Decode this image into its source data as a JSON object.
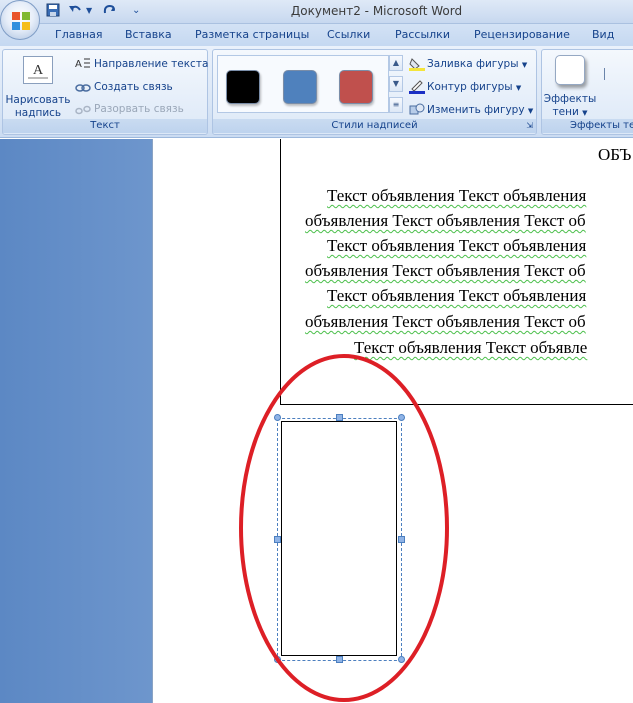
{
  "window": {
    "title": "Документ2 - Microsoft Word"
  },
  "tabs": [
    "Главная",
    "Вставка",
    "Разметка страницы",
    "Ссылки",
    "Рассылки",
    "Рецензирование",
    "Вид"
  ],
  "ribbon": {
    "text_group": {
      "label": "Текст",
      "draw_button": "Нарисовать надпись",
      "text_direction": "Направление текста",
      "create_link": "Создать связь",
      "break_link": "Разорвать связь"
    },
    "styles_group": {
      "label": "Стили надписей",
      "swatches": [
        "#000000",
        "#4f81bd",
        "#c0504d"
      ],
      "fill": "Заливка фигуры",
      "outline": "Контур фигуры",
      "change_shape": "Изменить фигуру"
    },
    "shadow_group": {
      "label": "Эффекты те",
      "button_line1": "Эффекты",
      "button_line2": "тени"
    }
  },
  "document": {
    "heading": "ОБЪ",
    "lines": [
      "Текст объявления  Текст объявления",
      "объявления  Текст объявления  Текст об",
      "Текст объявления  Текст объявления",
      "объявления  Текст объявления  Текст об",
      "Текст объявления  Текст объявления",
      "объявления  Текст объявления  Текст об",
      "Текст объявления   Текст объявле"
    ]
  },
  "annotation": {
    "color": "#dd1f26"
  }
}
